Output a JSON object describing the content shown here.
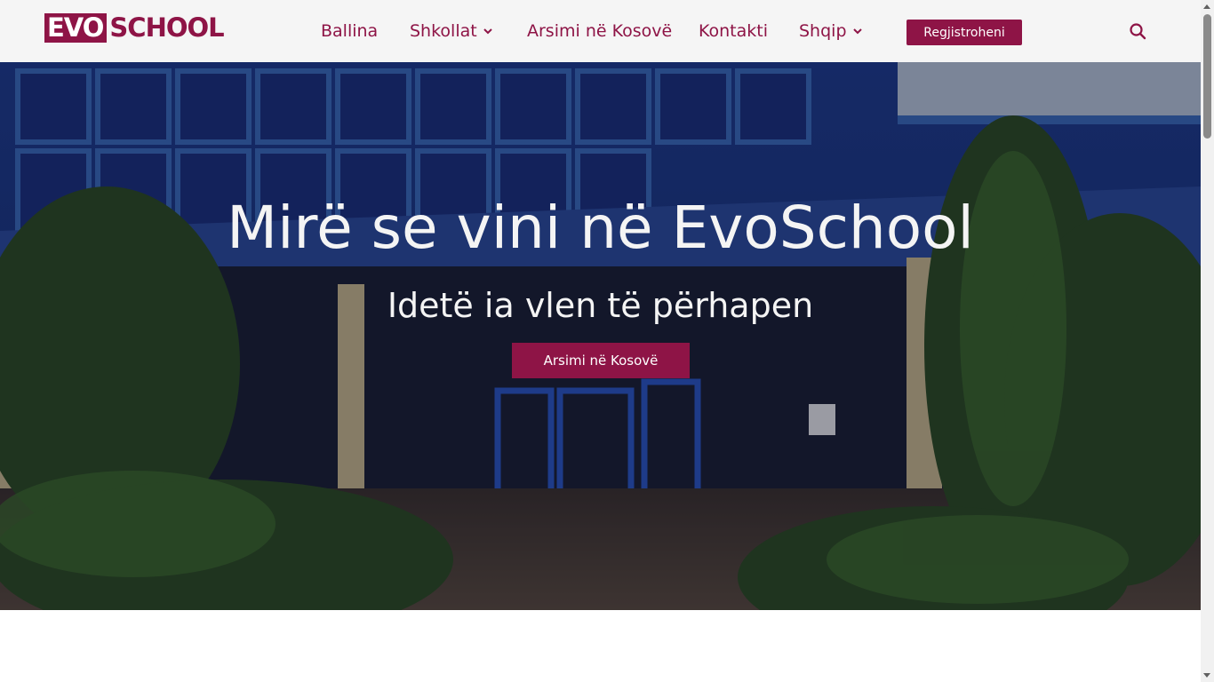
{
  "brand": {
    "logo_part1": "EVO",
    "logo_part2": "SCHOOL",
    "color": "#8e1446"
  },
  "nav": {
    "items": [
      {
        "label": "Ballina",
        "has_dropdown": false
      },
      {
        "label": "Shkollat",
        "has_dropdown": true,
        "icon": "chevron-down-icon"
      },
      {
        "label": "Arsimi në Kosovë",
        "has_dropdown": false
      },
      {
        "label": "Kontakti",
        "has_dropdown": false
      },
      {
        "label": "Shqip",
        "has_dropdown": true,
        "icon": "chevron-down-icon"
      }
    ],
    "register_label": "Regjistroheni",
    "search_icon": "search-icon"
  },
  "hero": {
    "title": "Mirë se vini në EvoSchool",
    "subtitle": "Idetë ia vlen të përhapen",
    "button_label": "Arsimi në Kosovë",
    "image": "school-building-photo"
  }
}
